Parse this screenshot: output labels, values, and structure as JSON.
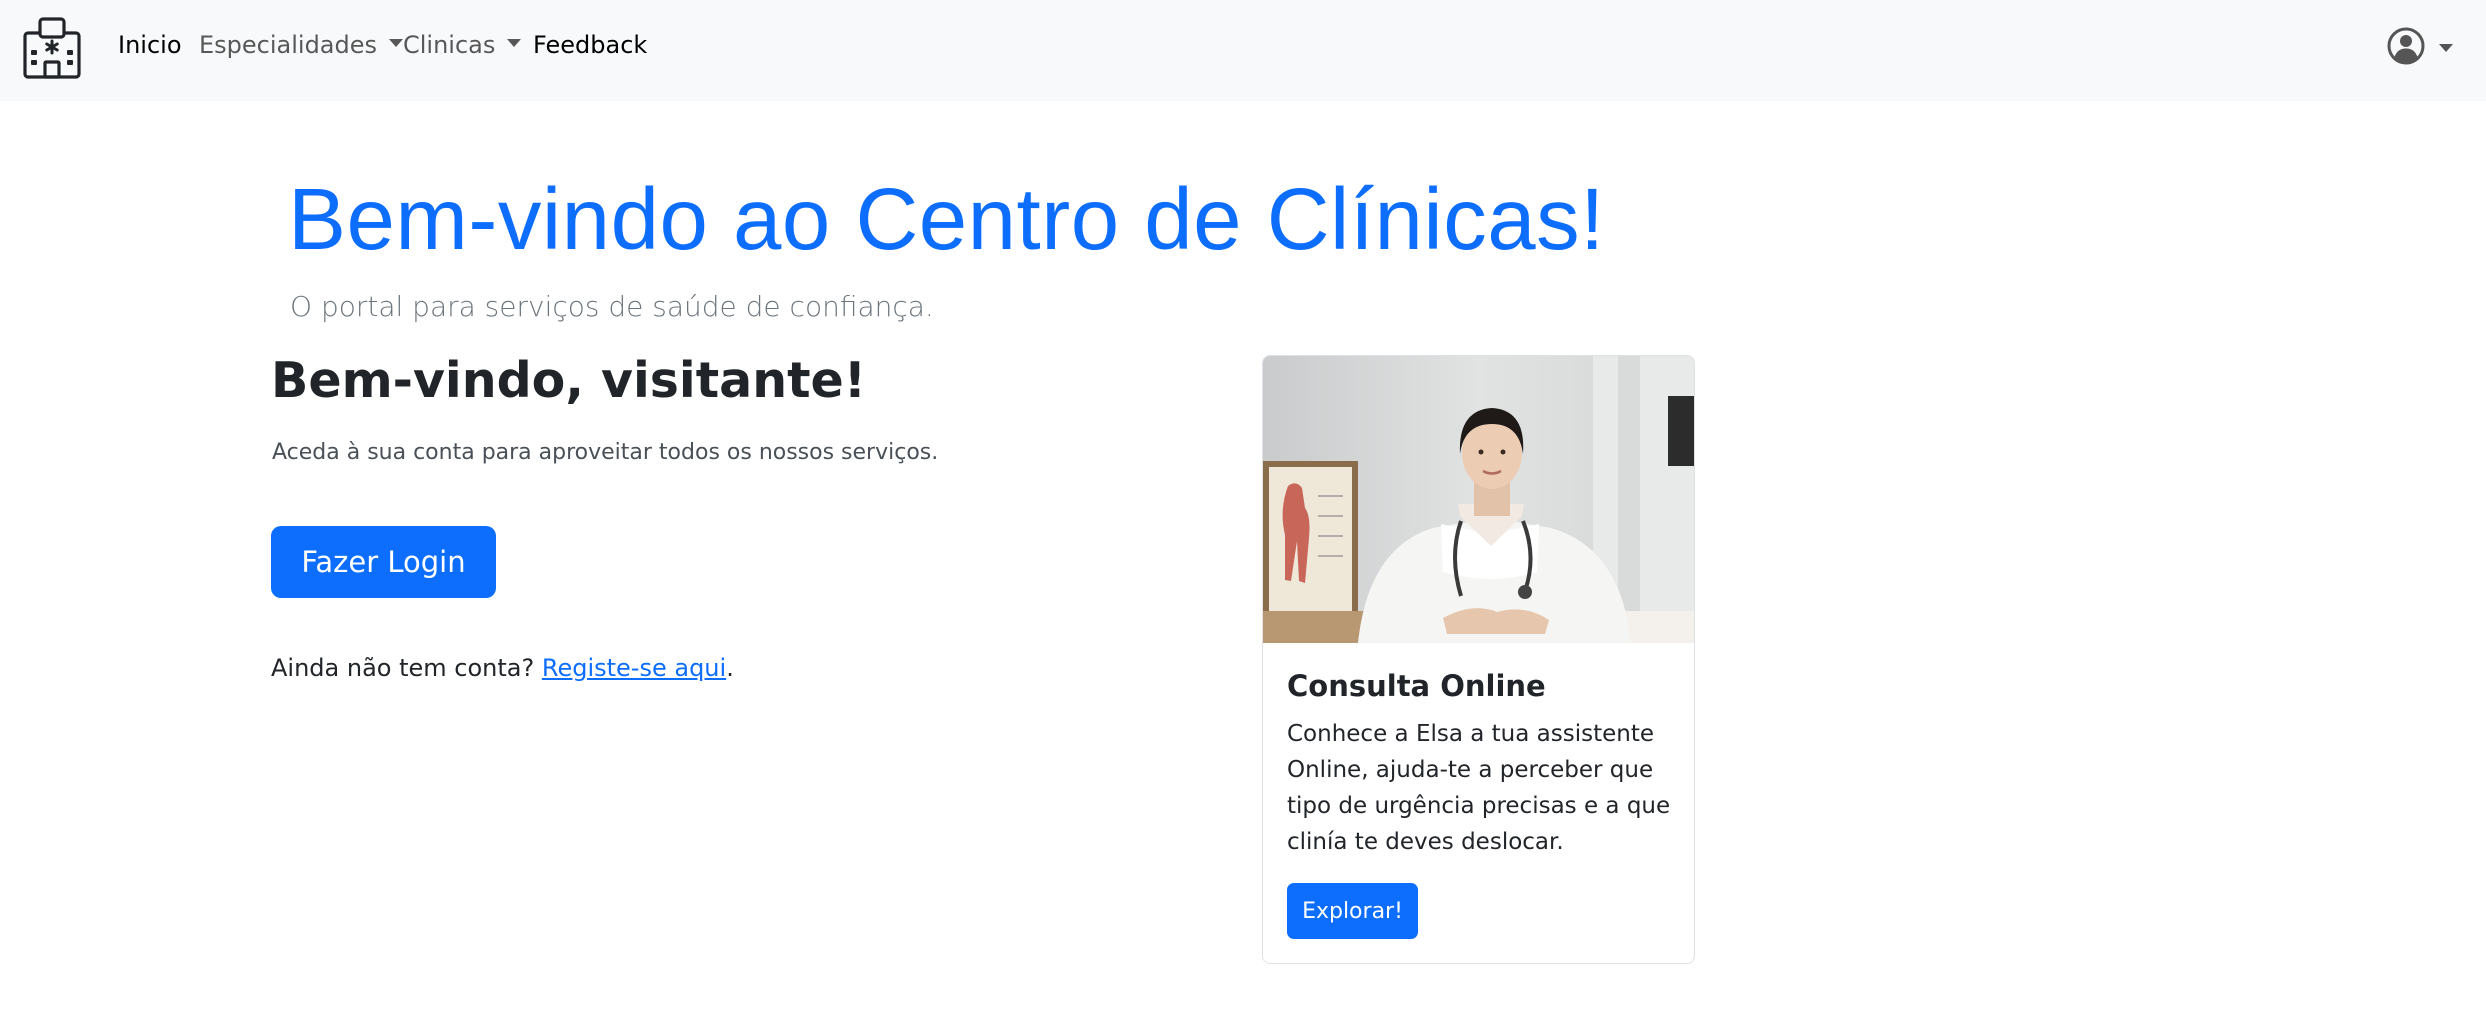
{
  "nav": {
    "brand_icon": "hospital-icon",
    "items": [
      {
        "label": "Inicio",
        "active": true
      },
      {
        "label": "Especialidades",
        "dropdown": true
      },
      {
        "label": "Clinicas",
        "dropdown": true
      },
      {
        "label": "Feedback",
        "active": true
      }
    ],
    "user_icon": "user-circle-icon"
  },
  "hero": {
    "title": "Bem-vindo ao Centro de Clínicas!",
    "lead": "O portal para serviços de saúde de confiança."
  },
  "welcome": {
    "heading": "Bem-vindo, visitante!",
    "text": "Aceda à sua conta para aproveitar todos os nossos serviços.",
    "login_label": "Fazer Login",
    "register_prefix": "Ainda não tem conta? ",
    "register_link": "Registe-se aqui",
    "register_suffix": "."
  },
  "card": {
    "image": "doctor-photo",
    "title": "Consulta Online",
    "text": "Conhece a Elsa a tua assistente Online, ajuda-te a perceber que tipo de urgência precisas e a que clinía te deves deslocar.",
    "button_label": "Explorar!"
  },
  "colors": {
    "primary": "#0d6efd",
    "navbar_bg": "#f8f9fa",
    "muted": "#6c757d"
  }
}
